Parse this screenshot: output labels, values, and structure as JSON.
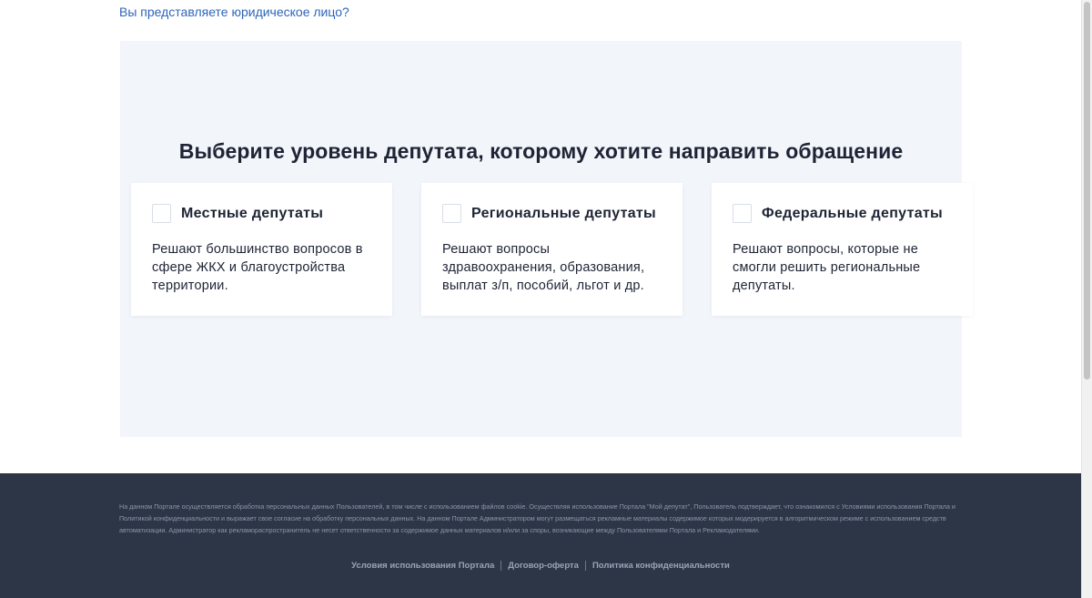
{
  "legal_entity_link": "Вы представляете юридическое лицо?",
  "panel": {
    "title": "Выберите уровень депутата, которому хотите направить обращение"
  },
  "cards": [
    {
      "title": "Местные депутаты",
      "description": "Решают большинство вопросов в сфере ЖКХ и благоустройства территории."
    },
    {
      "title": "Региональные депутаты",
      "description": "Решают вопросы здравоохранения, образования, выплат з/п, пособий, льгот и др."
    },
    {
      "title": "Федеральные депутаты",
      "description": "Решают вопросы, которые не смогли решить региональные депутаты."
    }
  ],
  "footer": {
    "disclaimer": "На данном Портале осуществляется обработка персональных данных Пользователей, в том числе с использованием файлов cookie. Осуществляя использование Портала \"Мой депутат\", Пользователь подтверждает, что ознакомился с Условиями использования Портала и Политикой конфиденциальности и выражает свое согласие на обработку персональных данных. На данном Портале Администратором могут размещаться рекламные материалы содержимое которых модерируется в алгоритмическом режиме с использованием средств автоматизации. Администратор как рекламораспространитель не несет ответственности за содержимое данных материалов и/или за споры, возникающие между Пользователями Портала и Рекламодателями.",
    "links": {
      "terms": "Условия использования Портала",
      "offer": "Договор-оферта",
      "privacy": "Политика конфиденциальности"
    }
  }
}
